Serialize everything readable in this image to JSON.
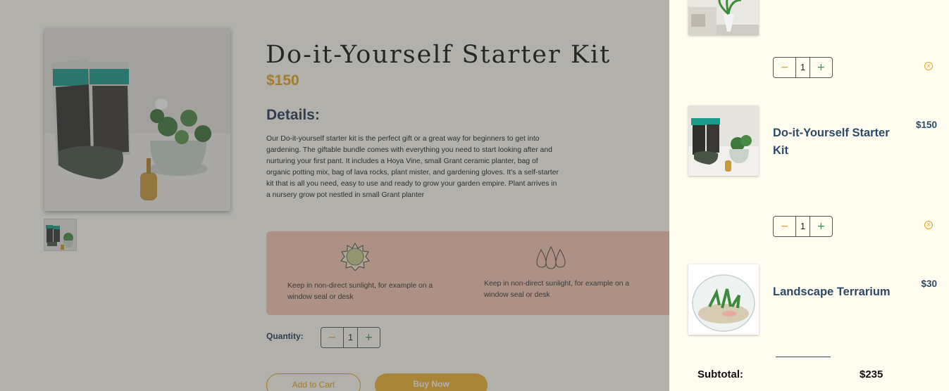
{
  "product": {
    "title": "Do-it-Yourself Starter Kit",
    "price": "$150",
    "details_heading": "Details:",
    "description": "Our Do-it-yourself starter kit is the perfect gift or a great way for beginners to get into gardening. The giftable bundle comes with everything you need to start looking after and nurturing your first pant. It includes a Hoya Vine, small Grant ceramic planter, bag of organic potting mix, bag of lava rocks, plant mister, and gardening gloves. It's a self-starter kit that is all you need, easy to use and ready to grow your garden empire. Plant arrives in a nursery grow pot nestled in small Grant planter",
    "care": [
      {
        "icon": "sun-icon",
        "text": "Keep in non-direct sunlight, for example on a window seal or desk"
      },
      {
        "icon": "water-drops-icon",
        "text": "Keep in non-direct sunlight, for example on a window seal or desk"
      }
    ],
    "quantity_label": "Quantity:",
    "quantity": "1",
    "add_to_cart": "Add to Cart",
    "buy_now": "Buy Now"
  },
  "stepper": {
    "minus": "−",
    "plus": "+"
  },
  "cart": {
    "items": [
      {
        "name": "",
        "price": "",
        "quantity": "1"
      },
      {
        "name": "Do-it-Yourself Starter Kit",
        "price": "$150",
        "quantity": "1"
      },
      {
        "name": "Landscape Terrarium",
        "price": "$30",
        "quantity": ""
      }
    ],
    "subtotal_label": "Subtotal:",
    "subtotal_value": "$235"
  },
  "colors": {
    "accent": "#e8a41b",
    "navy": "#2b4a6a",
    "green": "#1aa34a",
    "care_bg": "#f8c9b4",
    "drawer_bg": "#fffcf0"
  }
}
